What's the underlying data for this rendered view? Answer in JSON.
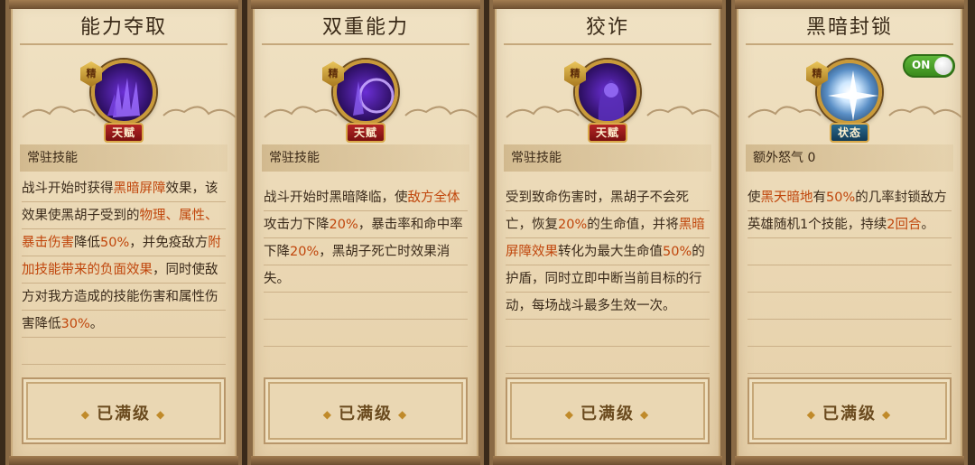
{
  "cards": [
    {
      "title": "能力夺取",
      "tier": "精",
      "type_label": "天赋",
      "icon": "purple-claw-icon",
      "section": "常驻技能",
      "desc_segments": [
        {
          "t": "战斗开始时获得",
          "h": false
        },
        {
          "t": "黑暗屏障",
          "h": true
        },
        {
          "t": "效果，该效果使黑胡子受到的",
          "h": false
        },
        {
          "t": "物理、属性、暴击伤害",
          "h": true
        },
        {
          "t": "降低",
          "h": false
        },
        {
          "t": "50%",
          "h": true
        },
        {
          "t": "，并免疫敌方",
          "h": false
        },
        {
          "t": "附加技能带来的负面效果",
          "h": true
        },
        {
          "t": "，同时使敌方对我方造成的技能伤害和属性伤害降低",
          "h": false
        },
        {
          "t": "30%",
          "h": true
        },
        {
          "t": "。",
          "h": false
        }
      ],
      "button": "已满级"
    },
    {
      "title": "双重能力",
      "tier": "精",
      "type_label": "天赋",
      "icon": "purple-orb-icon",
      "section": "常驻技能",
      "desc_segments": [
        {
          "t": "战斗开始时黑暗降临，使",
          "h": false
        },
        {
          "t": "敌方全体",
          "h": true
        },
        {
          "t": "攻击力下降",
          "h": false
        },
        {
          "t": "20%",
          "h": true
        },
        {
          "t": "，暴击率和命中率下降",
          "h": false
        },
        {
          "t": "20%",
          "h": true
        },
        {
          "t": "，黑胡子死亡时效果消失。",
          "h": false
        }
      ],
      "button": "已满级"
    },
    {
      "title": "狡诈",
      "tier": "精",
      "type_label": "天赋",
      "icon": "purple-shadow-icon",
      "section": "常驻技能",
      "desc_segments": [
        {
          "t": "受到致命伤害时，黑胡子不会死亡，恢复",
          "h": false
        },
        {
          "t": "20%",
          "h": true
        },
        {
          "t": "的生命值，并将",
          "h": false
        },
        {
          "t": "黑暗屏障效果",
          "h": true
        },
        {
          "t": "转化为最大生命值",
          "h": false
        },
        {
          "t": "50%",
          "h": true
        },
        {
          "t": "的护盾，同时立即中断当前目标的行动，每场战斗最多生效一次。",
          "h": false
        }
      ],
      "button": "已满级"
    },
    {
      "title": "黑暗封锁",
      "tier": "精",
      "type_label": "状态",
      "icon": "light-burst-icon",
      "section": "额外怒气 0",
      "toggle": "ON",
      "desc_segments": [
        {
          "t": "使",
          "h": false
        },
        {
          "t": "黑天暗地",
          "h": true
        },
        {
          "t": "有",
          "h": false
        },
        {
          "t": "50%",
          "h": true
        },
        {
          "t": "的几率封锁敌方英雄随机1个技能，持续",
          "h": false
        },
        {
          "t": "2回合",
          "h": true
        },
        {
          "t": "。",
          "h": false
        }
      ],
      "button": "已满级"
    }
  ],
  "colors": {
    "highlight": "#c0460c",
    "parchment": "#ead7b3",
    "frame": "#8a6a45",
    "toggle_on": "#4fa22a"
  }
}
